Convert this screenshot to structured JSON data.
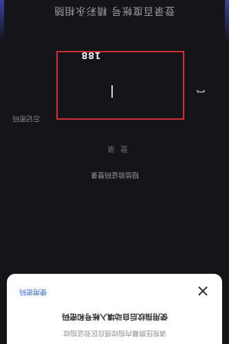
{
  "header": {
    "title": "登录百度帐号 精彩永相随"
  },
  "login_form": {
    "phone_number": "188",
    "forgot_password": "忘记密码",
    "login_button": "登录",
    "sms_login": "短信验证码登录"
  },
  "fingerprint_sheet": {
    "use_password": "使用密码",
    "title": "使用指纹后自动填入帐号和密码",
    "hint": "请按压屏幕内指纹感应区验证指纹"
  }
}
